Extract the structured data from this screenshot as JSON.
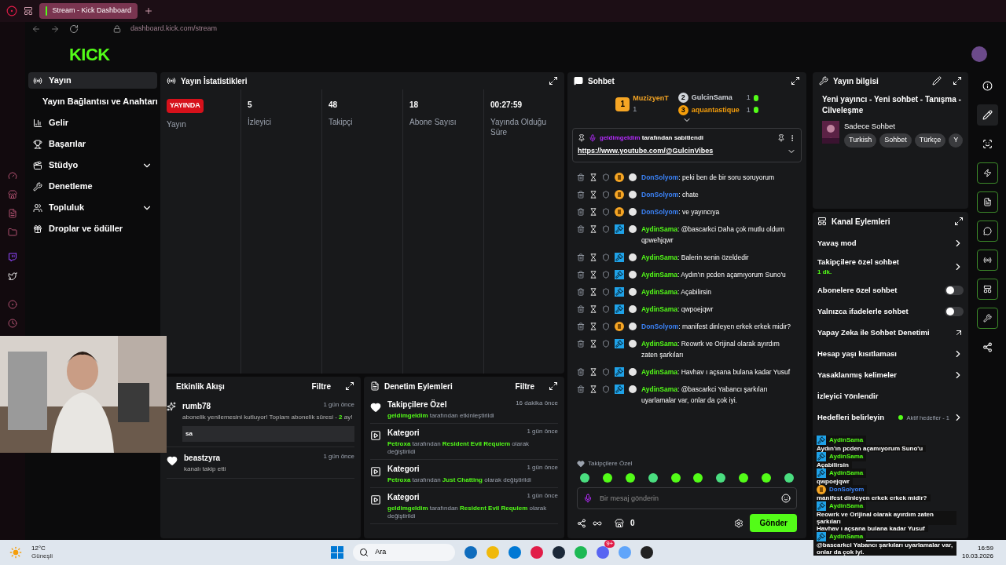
{
  "browser": {
    "tab_title": "Stream - Kick Dashboard",
    "url": "dashboard.kick.com/stream"
  },
  "header": {
    "logo": "KICK"
  },
  "nav": [
    {
      "label": "Yayın",
      "selected": true,
      "kind": "main",
      "chevron": false
    },
    {
      "label": "Yayın Bağlantısı ve Anahtarı",
      "selected": false,
      "kind": "sub",
      "chevron": false
    },
    {
      "label": "Gelir",
      "selected": false,
      "kind": "main",
      "chevron": false
    },
    {
      "label": "Başarılar",
      "selected": false,
      "kind": "main",
      "chevron": false
    },
    {
      "label": "Stüdyo",
      "selected": false,
      "kind": "main",
      "chevron": true
    },
    {
      "label": "Denetleme",
      "selected": false,
      "kind": "main",
      "chevron": false
    },
    {
      "label": "Topluluk",
      "selected": false,
      "kind": "main",
      "chevron": true
    },
    {
      "label": "Droplar ve ödüller",
      "selected": false,
      "kind": "main",
      "chevron": false
    }
  ],
  "stats": {
    "title": "Yayın İstatistikleri",
    "items": [
      {
        "kind": "badge",
        "value": "YAYINDA",
        "label": "Yayın"
      },
      {
        "kind": "number",
        "value": "5",
        "label": "İzleyici"
      },
      {
        "kind": "number",
        "value": "48",
        "label": "Takipçi"
      },
      {
        "kind": "number",
        "value": "18",
        "label": "Abone Sayısı"
      },
      {
        "kind": "number",
        "value": "00:27:59",
        "label": "Yayında Olduğu Süre"
      }
    ]
  },
  "events": {
    "title": "Etkinlik Akışı",
    "filter": "Filtre",
    "items": [
      {
        "kind": "sub",
        "user": "rumb78",
        "time": "1 gün önce",
        "parts": [
          {
            "text": "abonelik yenilemesini kutluyor! Toplam abonelik süresi - ",
            "hl": false
          },
          {
            "text": "2",
            "hl": true
          },
          {
            "text": " ay!",
            "hl": false
          }
        ],
        "message": "sa"
      },
      {
        "kind": "follow",
        "user": "beastzyra",
        "time": "1 gün önce",
        "parts": [
          {
            "text": "kanalı takip etti",
            "hl": false
          }
        ]
      }
    ]
  },
  "mod_actions": {
    "title": "Denetim Eylemleri",
    "filter": "Filtre",
    "items": [
      {
        "kind": "follow",
        "title": "Takipçilere Özel",
        "time": "16 dakika önce",
        "parts": [
          {
            "text": "geldimgeldim",
            "hl": true
          },
          {
            "text": " tarafından etkinleştirildi",
            "hl": false
          }
        ]
      },
      {
        "kind": "category",
        "title": "Kategori",
        "time": "1 gün önce",
        "parts": [
          {
            "text": "Petroxa",
            "hl": true
          },
          {
            "text": " tarafından ",
            "hl": false
          },
          {
            "text": "Resident Evil Requiem",
            "hl": true
          },
          {
            "text": " olarak değiştirildi",
            "hl": false
          }
        ]
      },
      {
        "kind": "category",
        "title": "Kategori",
        "time": "1 gün önce",
        "parts": [
          {
            "text": "Petroxa",
            "hl": true
          },
          {
            "text": " tarafından ",
            "hl": false
          },
          {
            "text": "Just Chatting",
            "hl": true
          },
          {
            "text": " olarak değiştirildi",
            "hl": false
          }
        ]
      },
      {
        "kind": "category",
        "title": "Kategori",
        "time": "1 gün önce",
        "parts": [
          {
            "text": "geldimgeldim",
            "hl": true
          },
          {
            "text": " tarafından ",
            "hl": false
          },
          {
            "text": "Resident Evil Requiem",
            "hl": true
          },
          {
            "text": " olarak değiştirildi",
            "hl": false
          }
        ]
      }
    ]
  },
  "chat": {
    "title": "Sohbet",
    "leaders": [
      {
        "rank": "1",
        "name": "MuzizyenT",
        "count": "1",
        "color": "#f5a524"
      },
      {
        "rank": "2",
        "name": "GulcinSama",
        "count": "1",
        "color": "#d1d5db"
      },
      {
        "rank": "3",
        "name": "aquantastique",
        "count": "1",
        "color": "#f59e0b"
      }
    ],
    "pinned": {
      "user": "geldimgeldim",
      "text": "tarafından sabitlendi",
      "link": "https://www.youtube.com/@GulcinVibes"
    },
    "messages": [
      {
        "kind": "sub",
        "user": "DonSolyom",
        "color": "#3b82f6",
        "text": ": peki ben de bir soru soruyorum"
      },
      {
        "kind": "sub",
        "user": "DonSolyom",
        "color": "#3b82f6",
        "text": ": chate"
      },
      {
        "kind": "sub",
        "user": "DonSolyom",
        "color": "#3b82f6",
        "text": ": ve yayıncıya"
      },
      {
        "kind": "mod",
        "user": "AydinSama",
        "color": "#53fc18",
        "text": ": @bascarkci Daha çok mutlu oldum qpwehjqwr"
      },
      {
        "kind": "mod",
        "user": "AydinSama",
        "color": "#53fc18",
        "text": ": Balerin senin özeldedir"
      },
      {
        "kind": "mod",
        "user": "AydinSama",
        "color": "#53fc18",
        "text": ": Aydın'ın pcden açamıyorum Suno'u"
      },
      {
        "kind": "mod",
        "user": "AydinSama",
        "color": "#53fc18",
        "text": ": Açabilirsin"
      },
      {
        "kind": "mod",
        "user": "AydinSama",
        "color": "#53fc18",
        "text": ": qwpoejqwr"
      },
      {
        "kind": "sub",
        "user": "DonSolyom",
        "color": "#3b82f6",
        "text": ": manifest dinleyen erkek erkek midir?"
      },
      {
        "kind": "mod",
        "user": "AydinSama",
        "color": "#53fc18",
        "text": ": Reowrk ve Orijinal olarak ayırdım zaten şarkıları"
      },
      {
        "kind": "mod",
        "user": "AydinSama",
        "color": "#53fc18",
        "text": ": Havhav ı açsana bulana kadar Yusuf"
      },
      {
        "kind": "mod",
        "user": "AydinSama",
        "color": "#53fc18",
        "text": ": @bascarkci Yabancı şarkıları uyarlamalar var, onlar da çok iyi."
      }
    ],
    "mode_label": "Takipçilere Özel",
    "placeholder": "Bir mesaj gönderin",
    "points": "0",
    "send": "Gönder"
  },
  "stream_info": {
    "title": "Yayın bilgisi",
    "stream_title": "Yeni yayıncı - Yeni sohbet - Tanışma - Cilveleşme",
    "category": "Sadece Sohbet",
    "tags": [
      "Turkish",
      "Sohbet",
      "Türkçe",
      "Y"
    ]
  },
  "channel_actions": {
    "title": "Kanal Eylemleri",
    "items": [
      {
        "kind": "chevron",
        "label": "Yavaş mod"
      },
      {
        "kind": "chevron",
        "label": "Takipçilere özel sohbet",
        "sub": "1 dk."
      },
      {
        "kind": "toggle",
        "label": "Abonelere özel sohbet",
        "on": false
      },
      {
        "kind": "toggle",
        "label": "Yalnızca ifadelerle sohbet",
        "on": false
      },
      {
        "kind": "external",
        "label": "Yapay Zeka ile Sohbet Denetimi"
      },
      {
        "kind": "chevron",
        "label": "Hesap yaşı kısıtlaması"
      },
      {
        "kind": "chevron",
        "label": "Yasaklanmış kelimeler"
      },
      {
        "kind": "plain",
        "label": "İzleyici Yönlendir"
      },
      {
        "kind": "goal",
        "label": "Hedefleri belirleyin",
        "status": "Aktif hedefler - 1"
      }
    ]
  },
  "overlay_chat": [
    {
      "kind": "mod",
      "user": "AydinSama",
      "color": "#53fc18",
      "text": "Aydın'ın pcden açamıyorum Suno'u"
    },
    {
      "kind": "mod",
      "user": "AydinSama",
      "color": "#53fc18",
      "text": "Açabilirsin"
    },
    {
      "kind": "mod",
      "user": "AydinSama",
      "color": "#53fc18",
      "text": "qwpoejqwr"
    },
    {
      "kind": "sub",
      "user": "DonSolyom",
      "color": "#3b82f6",
      "text": "manifest dinleyen erkek erkek midir?"
    },
    {
      "kind": "mod",
      "user": "AydinSama",
      "color": "#53fc18",
      "text": "Reowrk ve Orijinal olarak ayırdım zaten şarkıları"
    },
    {
      "kind": "none",
      "text": "Havhav ı açsana bulana kadar Yusuf"
    },
    {
      "kind": "mod",
      "user": "AydinSama",
      "color": "#53fc18",
      "text": "@bascarkci Yabancı şarkıları uyarlamalar var, onlar da çok iyi."
    }
  ],
  "taskbar": {
    "temperature": "12°C",
    "weather": "Güneşli",
    "search": "Ara",
    "time": "16:59",
    "date": "10.03.2026",
    "discord_badge": "9+"
  }
}
